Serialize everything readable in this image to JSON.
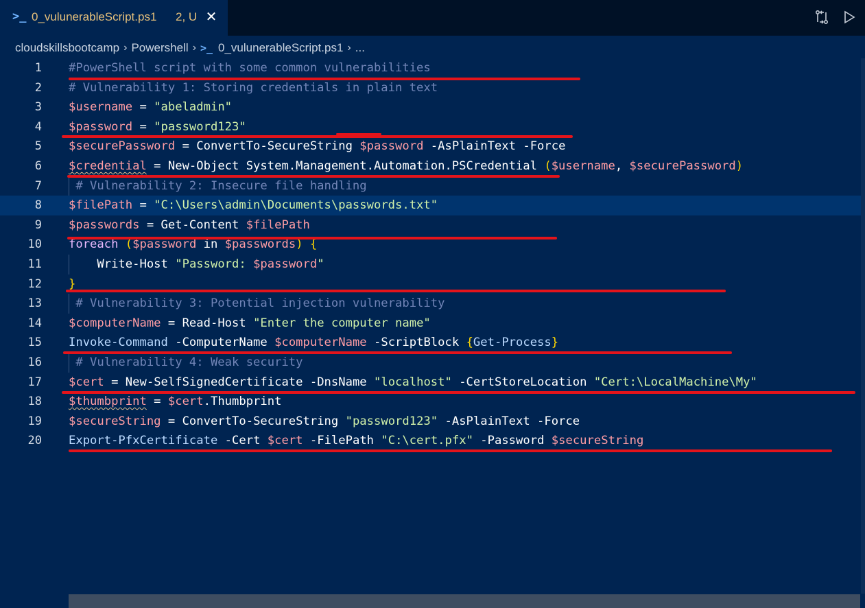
{
  "tab": {
    "title": "0_vulunerableScript.ps1",
    "badge": "2, U",
    "close_glyph": "✕"
  },
  "breadcrumb": {
    "items": [
      "cloudskillsbootcamp",
      "Powershell",
      "0_vulunerableScript.ps1",
      "..."
    ]
  },
  "editor": {
    "current_line": 8,
    "lines": [
      {
        "n": "1",
        "text": "#PowerShell script with some common vulnerabilities"
      },
      {
        "n": "2",
        "text": "# Vulnerability 1: Storing credentials in plain text"
      },
      {
        "n": "3",
        "text": "$username = \"abeladmin\""
      },
      {
        "n": "4",
        "text": "$password = \"password123\""
      },
      {
        "n": "5",
        "text": "$securePassword = ConvertTo-SecureString $password -AsPlainText -Force"
      },
      {
        "n": "6",
        "text": "$credential = New-Object System.Management.Automation.PSCredential ($username, $securePassword)"
      },
      {
        "n": "7",
        "text": " # Vulnerability 2: Insecure file handling"
      },
      {
        "n": "8",
        "text": "$filePath = \"C:\\Users\\admin\\Documents\\passwords.txt\""
      },
      {
        "n": "9",
        "text": "$passwords = Get-Content $filePath"
      },
      {
        "n": "10",
        "text": "foreach ($password in $passwords) {"
      },
      {
        "n": "11",
        "text": "    Write-Host \"Password: $password\""
      },
      {
        "n": "12",
        "text": "}"
      },
      {
        "n": "13",
        "text": " # Vulnerability 3: Potential injection vulnerability"
      },
      {
        "n": "14",
        "text": "$computerName = Read-Host \"Enter the computer name\""
      },
      {
        "n": "15",
        "text": "Invoke-Command -ComputerName $computerName -ScriptBlock {Get-Process}"
      },
      {
        "n": "16",
        "text": " # Vulnerability 4: Weak security"
      },
      {
        "n": "17",
        "text": "$cert = New-SelfSignedCertificate -DnsName \"localhost\" -CertStoreLocation \"Cert:\\LocalMachine\\My\""
      },
      {
        "n": "18",
        "text": "$thumbprint = $cert.Thumbprint"
      },
      {
        "n": "19",
        "text": "$secureString = ConvertTo-SecureString \"password123\" -AsPlainText -Force"
      },
      {
        "n": "20",
        "text": "Export-PfxCertificate -Cert $cert -FilePath \"C:\\cert.pfx\" -Password $secureString"
      }
    ]
  },
  "colors": {
    "editor_bg": "#002451",
    "tabbar_bg": "#001126",
    "annotation_red": "#e3141b",
    "comment": "#7285b7",
    "variable": "#ff9da4",
    "string": "#d1f1a9",
    "command": "#bbdaff"
  },
  "icons": {
    "tab_file": "powershell-icon",
    "compare": "git-compare-icon",
    "run": "run-play-icon"
  }
}
